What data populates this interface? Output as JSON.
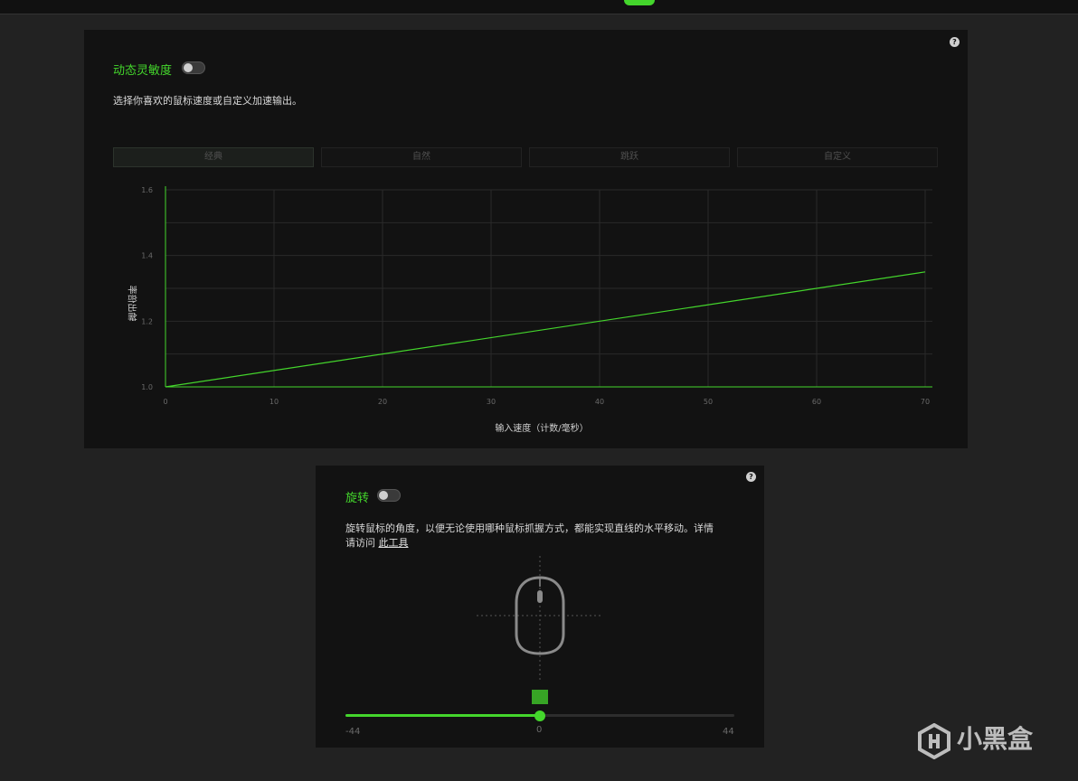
{
  "colors": {
    "accent": "#44d62c",
    "panel": "#121212",
    "background": "#222222"
  },
  "sensitivity": {
    "title": "动态灵敏度",
    "toggle_on": false,
    "description": "选择你喜欢的鼠标速度或自定义加速输出。",
    "help": "?",
    "tabs": [
      {
        "label": "经典",
        "active": true
      },
      {
        "label": "自然",
        "active": false
      },
      {
        "label": "跳跃",
        "active": false
      },
      {
        "label": "自定义",
        "active": false
      }
    ]
  },
  "chart_data": {
    "type": "line",
    "xlabel": "输入速度（计数/毫秒）",
    "ylabel": "输出倍率",
    "xlim": [
      0,
      70
    ],
    "ylim": [
      1.0,
      1.6
    ],
    "xticks": [
      0,
      10,
      20,
      30,
      40,
      50,
      60,
      70
    ],
    "yticks": [
      1.0,
      1.2,
      1.4,
      1.6
    ],
    "ytick_labels": [
      "1.0",
      "1.2",
      "1.4",
      "1.6"
    ],
    "grid": true,
    "series": [
      {
        "x": [
          0,
          70
        ],
        "y": [
          1.0,
          1.35
        ]
      }
    ]
  },
  "rotation": {
    "title": "旋转",
    "toggle_on": false,
    "help": "?",
    "description_line1": "旋转鼠标的角度，以便无论使用哪种鼠标抓握方式，都能实现直线的水平移动。详情",
    "description_line2_prefix": "请访问 ",
    "link_text": "此工具",
    "slider": {
      "min": -44,
      "max": 44,
      "value": 0,
      "min_label": "-44",
      "max_label": "44",
      "value_label": "0"
    }
  },
  "watermark": {
    "text": "小黑盒",
    "icon": "heybox-logo-icon"
  }
}
